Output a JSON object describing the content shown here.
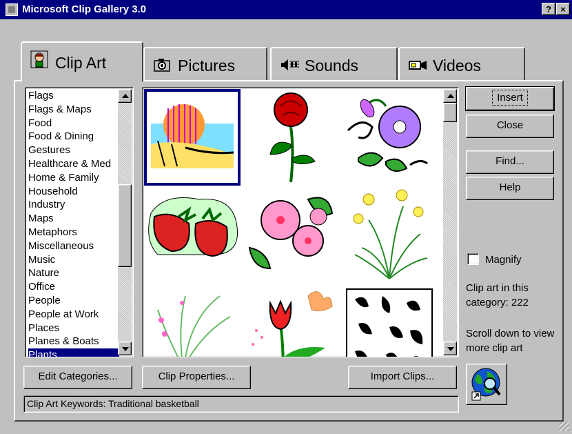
{
  "window": {
    "title": "Microsoft Clip Gallery 3.0",
    "help_glyph": "?",
    "close_glyph": "×"
  },
  "tabs": [
    {
      "label": "Clip Art",
      "icon": "clip-art-person-icon"
    },
    {
      "label": "Pictures",
      "icon": "camera-icon"
    },
    {
      "label": "Sounds",
      "icon": "speaker-notes-icon"
    },
    {
      "label": "Videos",
      "icon": "video-camera-icon"
    }
  ],
  "categories": {
    "items": [
      "Flags",
      "Flags & Maps",
      "Food",
      "Food & Dining",
      "Gestures",
      "Healthcare & Med",
      "Home & Family",
      "Household",
      "Industry",
      "Maps",
      "Metaphors",
      "Miscellaneous",
      "Music",
      "Nature",
      "Office",
      "People",
      "People at Work",
      "Places",
      "Planes & Boats",
      "Plants"
    ],
    "selected": "Plants"
  },
  "gallery": {
    "clips": [
      "sunset-ocean-clip",
      "rose-clip",
      "morning-glory-clip",
      "strawberries-clip",
      "pink-blossoms-clip",
      "daffodils-clip",
      "grass-flowers-clip",
      "tulip-butterfly-clip",
      "leaf-pattern-clip"
    ],
    "selected_index": 0
  },
  "buttons": {
    "insert": "Insert",
    "close": "Close",
    "find": "Find...",
    "help": "Help",
    "edit_categories": "Edit Categories...",
    "clip_properties": "Clip Properties...",
    "import_clips": "Import Clips..."
  },
  "magnify": {
    "label": "Magnify",
    "checked": false
  },
  "info": {
    "count_text": "Clip art in this category: 222",
    "scroll_hint": "Scroll down to view more clip art"
  },
  "status": {
    "keywords": "Clip Art Keywords:  Traditional basketball"
  },
  "colors": {
    "title_bar": "#000080",
    "face": "#c0c0c0",
    "selection": "#000080"
  }
}
